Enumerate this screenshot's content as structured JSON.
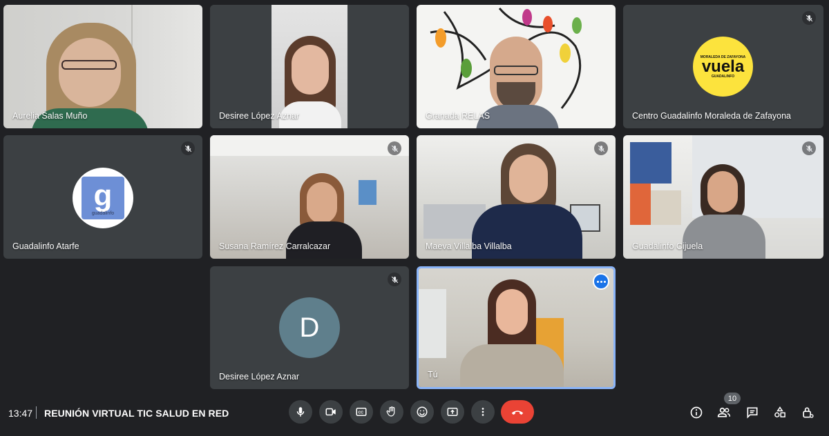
{
  "participants": [
    {
      "name": "Aurelia Salas Muño",
      "muted": false
    },
    {
      "name": "Desiree López Aznar",
      "muted": false
    },
    {
      "name": "Granada RELAS",
      "muted": false
    },
    {
      "name": "Centro Guadalinfo Moraleda de Zafayona",
      "muted": true,
      "logo_text": "vuela",
      "logo_top": "MORALEDA DE ZAFAYONA",
      "logo_bottom": "GUADALINFO"
    },
    {
      "name": "Guadalinfo Atarfe",
      "muted": true,
      "logo_text": "g",
      "logo_sub": "guadalinfo"
    },
    {
      "name": "Susana Ramírez Carralcazar",
      "muted": true
    },
    {
      "name": "Maeva Villalba Villalba",
      "muted": true
    },
    {
      "name": "Guadalinfo Cijuela",
      "muted": true
    },
    {
      "name": "Desiree López Aznar",
      "muted": true,
      "initial": "D"
    },
    {
      "name": "Tú",
      "muted": false,
      "self": true
    }
  ],
  "footer": {
    "time": "13:47",
    "meeting_title": "REUNIÓN VIRTUAL TIC SALUD EN RED",
    "participant_count": "10"
  },
  "controls": [
    "mic-icon",
    "camera-icon",
    "captions-icon",
    "raise-hand-icon",
    "emoji-icon",
    "present-icon",
    "more-options-icon",
    "hang-up-icon"
  ],
  "side_controls": [
    "info-icon",
    "people-icon",
    "chat-icon",
    "activities-icon",
    "host-controls-icon"
  ],
  "colors": {
    "background": "#202124",
    "tile": "#3c4043",
    "hangup": "#ea4335",
    "self_border": "#8ab4f8",
    "vuela_yellow": "#fce33d",
    "guadalinfo_blue": "#6d8fd6"
  }
}
